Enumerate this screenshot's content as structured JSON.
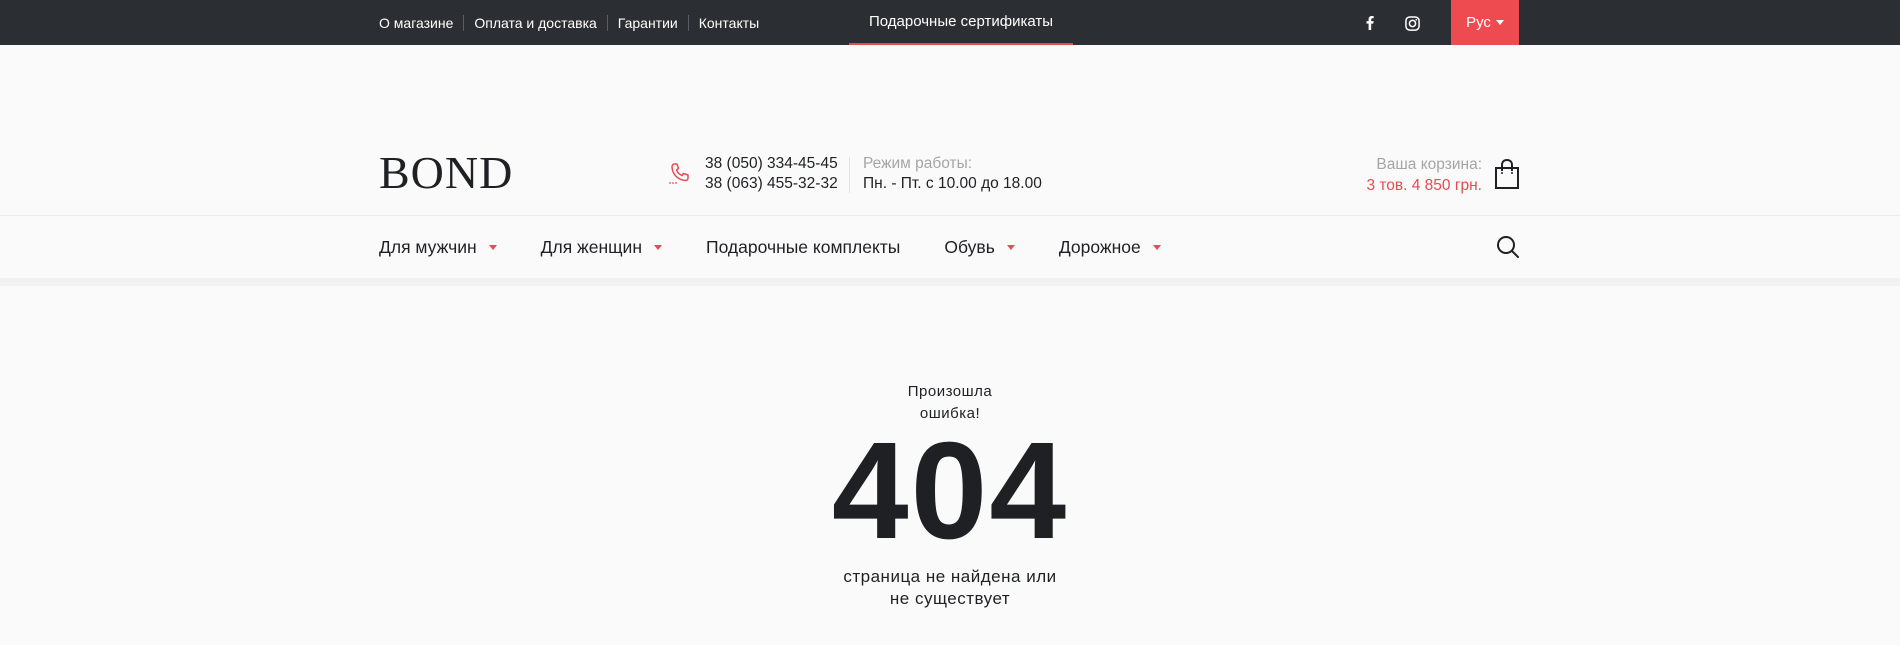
{
  "topbar": {
    "links": [
      "О магазине",
      "Оплата и доставка",
      "Гарантии",
      "Контакты"
    ],
    "certificates": "Подарочные сертификаты",
    "social": [
      "facebook-icon",
      "instagram-icon"
    ],
    "language": "Рус"
  },
  "header": {
    "logo": "BOND",
    "phones": [
      "38 (050) 334-45-45",
      "38 (063) 455-32-32"
    ],
    "hours_label": "Режим работы:",
    "hours_value": "Пн. - Пт. с 10.00 до 18.00",
    "cart_label": "Ваша корзина:",
    "cart_value": "3 тов. 4 850 грн."
  },
  "nav": {
    "items": [
      "Для мужчин",
      "Для женщин",
      "Подарочные комплекты",
      "Обувь",
      "Дорожное"
    ]
  },
  "error": {
    "title_line1": "Произошла",
    "title_line2": "ошибка!",
    "code": "404",
    "subtitle_line1": "страница не найдена или",
    "subtitle_line2": "не существует"
  },
  "colors": {
    "topbar_bg": "#2b2e33",
    "accent": "#ee4b50",
    "text": "#1f2024",
    "muted": "#a5a5a5",
    "page_bg": "#fafafa"
  }
}
